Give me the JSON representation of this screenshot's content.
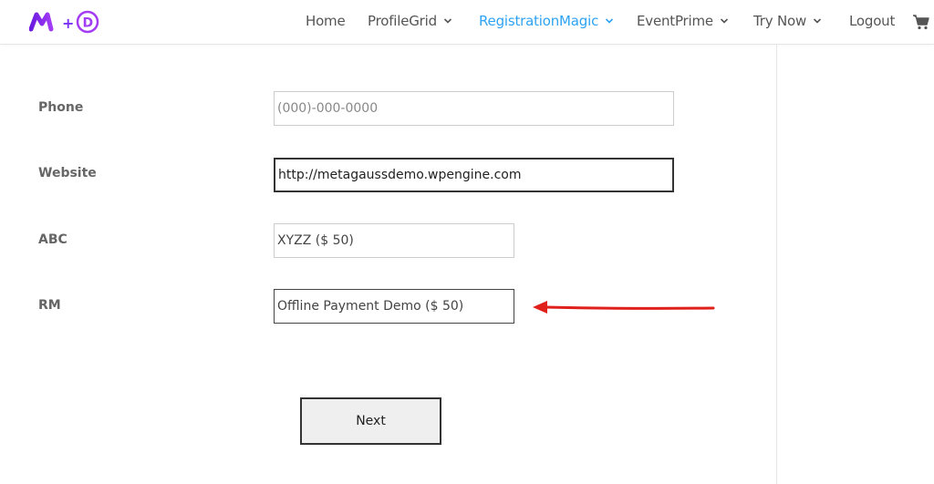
{
  "nav": {
    "items": [
      {
        "label": "Home",
        "has_dropdown": false,
        "active": false
      },
      {
        "label": "ProfileGrid",
        "has_dropdown": true,
        "active": false
      },
      {
        "label": "RegistrationMagic",
        "has_dropdown": true,
        "active": true
      },
      {
        "label": "EventPrime",
        "has_dropdown": true,
        "active": false
      },
      {
        "label": "Try Now",
        "has_dropdown": true,
        "active": false
      },
      {
        "label": "Logout",
        "has_dropdown": false,
        "active": false
      }
    ],
    "cart_icon": "shopping-cart-icon"
  },
  "logo": {
    "icon": "m-plus-d-logo",
    "color": "#7b2ff7"
  },
  "form": {
    "phone": {
      "label": "Phone",
      "placeholder": "(000)-000-0000"
    },
    "website": {
      "label": "Website",
      "value": "http://metagaussdemo.wpengine.com"
    },
    "abc": {
      "label": "ABC",
      "value": "XYZZ ($ 50)"
    },
    "rm": {
      "label": "RM",
      "value": "Offline Payment Demo ($ 50)"
    },
    "next_label": "Next"
  },
  "colors": {
    "accent": "#2ea3f2",
    "arrow": "#e0201b",
    "text": "#666666"
  }
}
